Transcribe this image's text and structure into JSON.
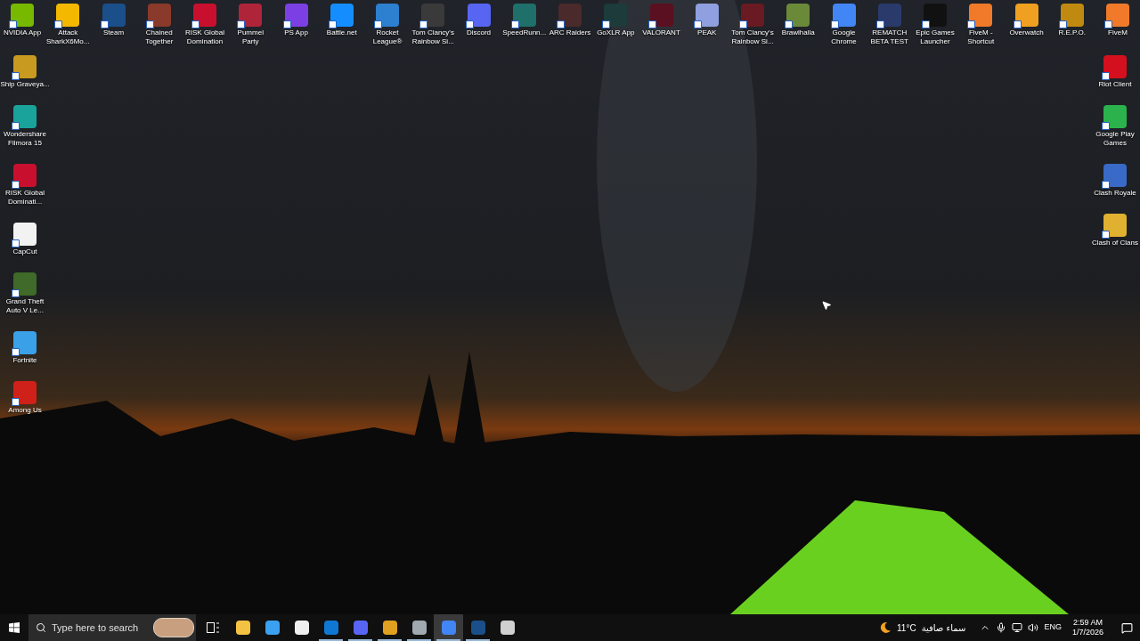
{
  "desktop": {
    "top_row": [
      {
        "label": "NVIDIA App",
        "color": "#76b900"
      },
      {
        "label": "Attack SharkX6Mo...",
        "color": "#f5b800"
      },
      {
        "label": "Steam",
        "color": "#1b4f8a"
      },
      {
        "label": "Chained Together",
        "color": "#8a3a2a"
      },
      {
        "label": "RISK Global Domination",
        "color": "#c8102e"
      },
      {
        "label": "Pummel Party",
        "color": "#b0243a"
      },
      {
        "label": "PS App",
        "color": "#7b3fe4"
      },
      {
        "label": "Battle.net",
        "color": "#148eff"
      },
      {
        "label": "Rocket League®",
        "color": "#2d7fd0"
      },
      {
        "label": "Tom Clancy's Rainbow Si...",
        "color": "#3a3a3a"
      },
      {
        "label": "Discord",
        "color": "#5865f2"
      },
      {
        "label": "SpeedRunn...",
        "color": "#1f6f6a"
      },
      {
        "label": "ARC Raiders",
        "color": "#4a2a2a"
      },
      {
        "label": "GoXLR App",
        "color": "#1c3b3a"
      },
      {
        "label": "VALORANT",
        "color": "#5a1020"
      },
      {
        "label": "PEAK",
        "color": "#8f9fe0"
      },
      {
        "label": "Tom Clancy's Rainbow Si...",
        "color": "#6a1a22"
      },
      {
        "label": "Brawlhalla",
        "color": "#6a8a3a"
      },
      {
        "label": "Google Chrome",
        "color": "#4285f4"
      },
      {
        "label": "REMATCH BETA TEST",
        "color": "#2a3a6a"
      },
      {
        "label": "Epic Games Launcher",
        "color": "#111111"
      },
      {
        "label": "FiveM - Shortcut",
        "color": "#f07a2a"
      },
      {
        "label": "Overwatch",
        "color": "#f0a020"
      },
      {
        "label": "R.E.P.O.",
        "color": "#c08a10"
      },
      {
        "label": "FiveM",
        "color": "#f07a2a"
      }
    ],
    "left_column": [
      {
        "label": "Ship Graveya...",
        "color": "#c89a20"
      },
      {
        "label": "Wondershare Filmora 15",
        "color": "#1aa39a"
      },
      {
        "label": "RISK Global Dominati...",
        "color": "#c8102e"
      },
      {
        "label": "CapCut",
        "color": "#f2f2f2"
      },
      {
        "label": "Grand Theft Auto V Le...",
        "color": "#3f6a2a"
      },
      {
        "label": "Fortnite",
        "color": "#3aa0e8"
      },
      {
        "label": "Among Us",
        "color": "#d0201a"
      }
    ],
    "right_column": [
      {
        "label": "Riot Client",
        "color": "#d4101e"
      },
      {
        "label": "Google Play Games",
        "color": "#2bb24c"
      },
      {
        "label": "Clash Royale",
        "color": "#3a6ac8"
      },
      {
        "label": "Clash of Clans",
        "color": "#e0b030"
      }
    ]
  },
  "taskbar": {
    "search": {
      "placeholder": "Type here to search"
    },
    "apps": [
      {
        "color": "#f4c242",
        "running": false,
        "selected": false
      },
      {
        "color": "#3aa0f0",
        "running": false,
        "selected": false
      },
      {
        "color": "#f0f0f0",
        "running": false,
        "selected": false
      },
      {
        "color": "#0f78d4",
        "running": true,
        "selected": false
      },
      {
        "color": "#5865f2",
        "running": true,
        "selected": false
      },
      {
        "color": "#e0a020",
        "running": true,
        "selected": false
      },
      {
        "color": "#a0a8b0",
        "running": true,
        "selected": false
      },
      {
        "color": "#4285f4",
        "running": true,
        "selected": true
      },
      {
        "color": "#1b4f8a",
        "running": true,
        "selected": false
      },
      {
        "color": "#d0d0d0",
        "running": false,
        "selected": false
      }
    ],
    "weather": {
      "temperature": "11°C",
      "condition": "سماء صافية"
    },
    "language": "ENG",
    "time": "2:59 AM",
    "date": "1/7/2026"
  }
}
